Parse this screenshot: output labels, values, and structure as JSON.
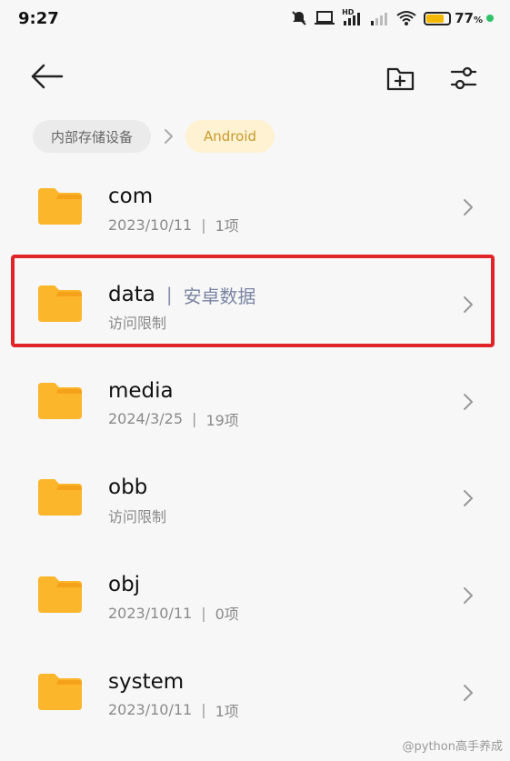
{
  "status_bar": {
    "time": "9:27",
    "battery_percent": "77",
    "battery_level": 0.77,
    "percent_sign": "%",
    "hd_label": "HD"
  },
  "toolbar": {
    "back_icon": "arrow-left-icon",
    "new_folder_icon": "folder-plus-icon",
    "filter_icon": "sliders-icon"
  },
  "breadcrumb": {
    "root": "内部存储设备",
    "current": "Android"
  },
  "items": [
    {
      "name": "com",
      "date": "2023/10/11",
      "count": "1项"
    },
    {
      "name": "data",
      "alias": "安卓数据",
      "status": "访问限制"
    },
    {
      "name": "media",
      "date": "2024/3/25",
      "count": "19项"
    },
    {
      "name": "obb",
      "status": "访问限制"
    },
    {
      "name": "obj",
      "date": "2023/10/11",
      "count": "0项"
    },
    {
      "name": "system",
      "date": "2023/10/11",
      "count": "1项"
    }
  ],
  "colors": {
    "folder": "#fbb62b",
    "folder_tab": "#f5a21a",
    "highlight": "#e0242a",
    "crumb_current_bg": "#fff2d2",
    "crumb_current_text": "#c99a2a"
  },
  "watermark": "@python高手养成"
}
